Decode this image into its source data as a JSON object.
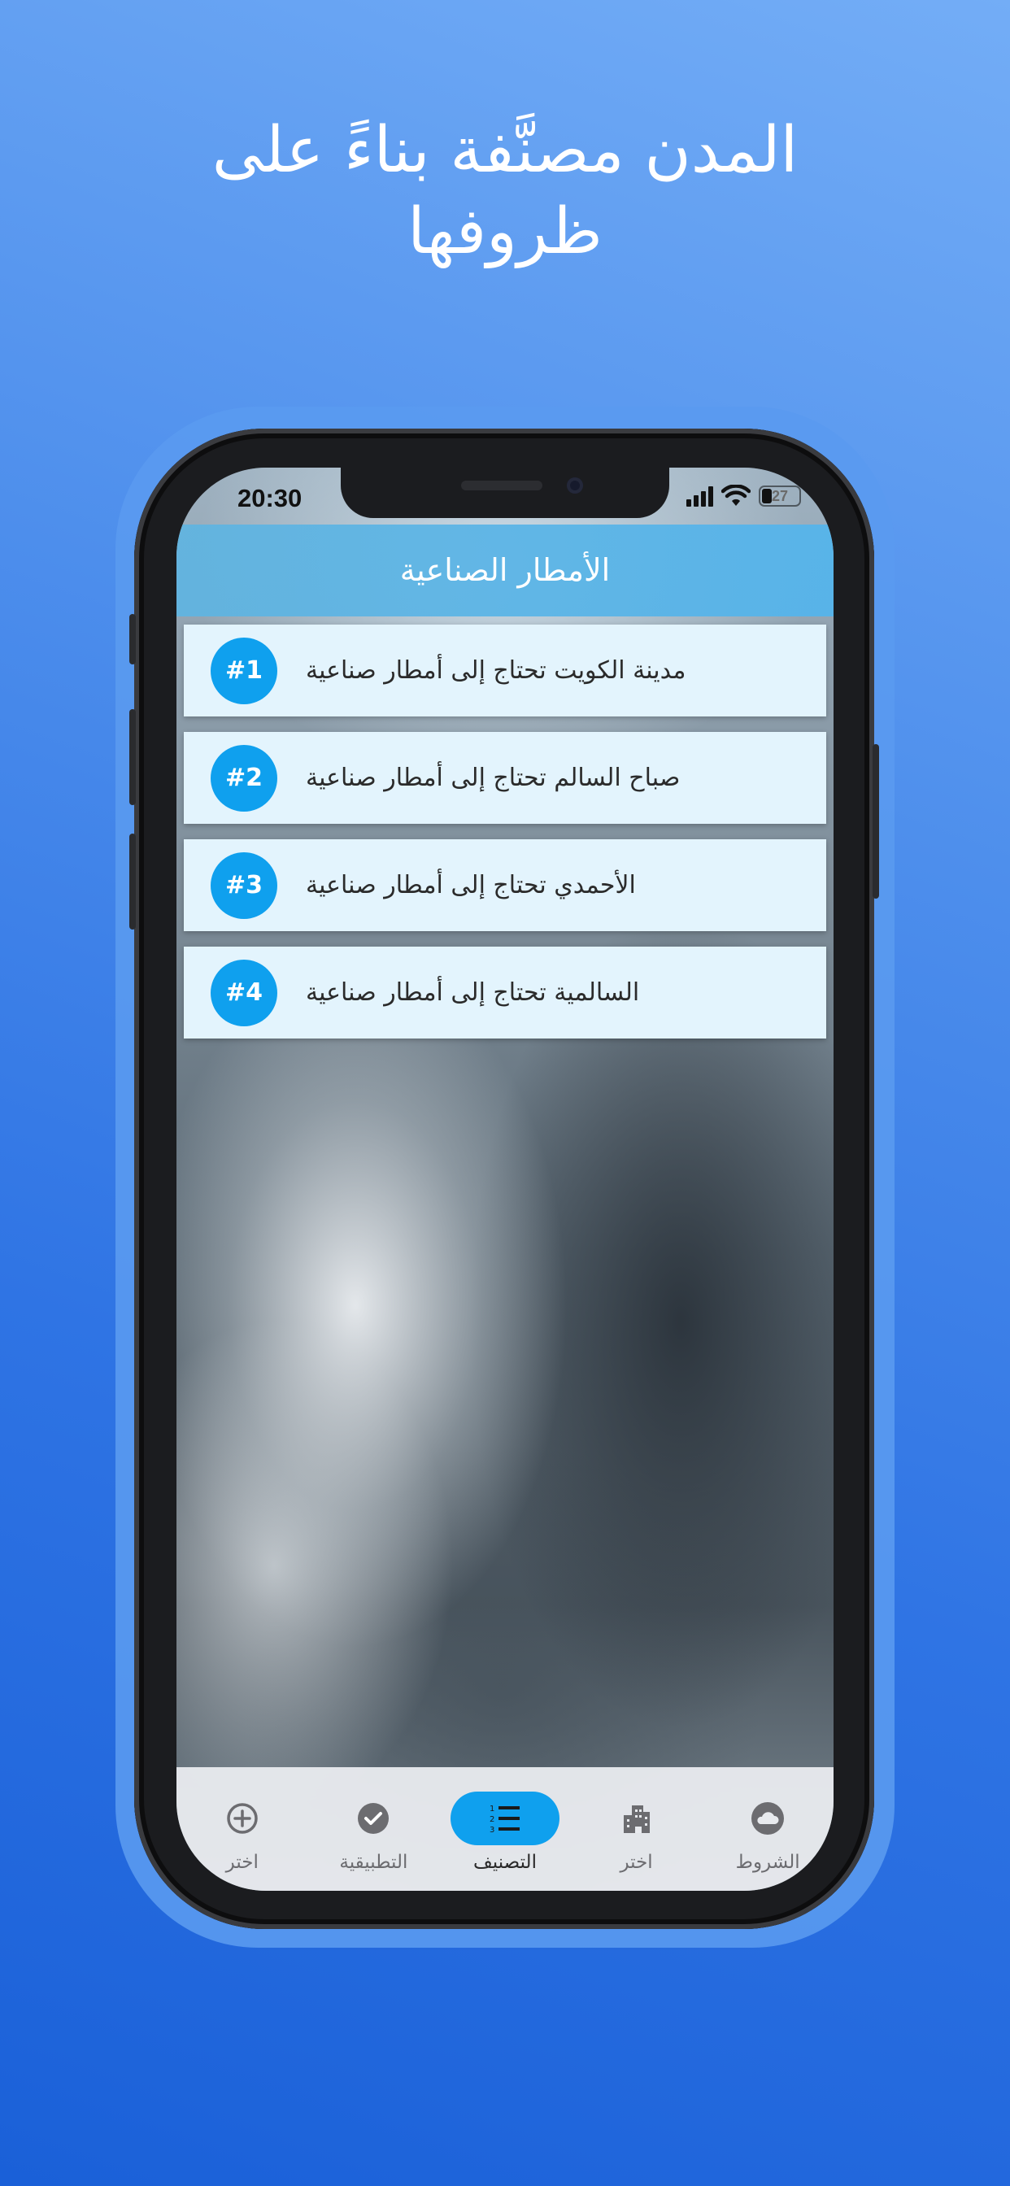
{
  "headline": {
    "line1": "المدن مصنَّفة بناءً على",
    "line2": "ظروفها"
  },
  "status_bar": {
    "time": "20:30",
    "battery_level": "27",
    "icons": [
      "cellular-signal-icon",
      "wifi-icon",
      "battery-icon"
    ]
  },
  "app": {
    "title": "الأمطار الصناعية",
    "items": [
      {
        "badge": "#1",
        "text": "مدينة الكويت تحتاج إلى أمطار صناعية"
      },
      {
        "badge": "#2",
        "text": "صباح السالم تحتاج إلى أمطار صناعية"
      },
      {
        "badge": "#3",
        "text": "الأحمدي تحتاج إلى أمطار صناعية"
      },
      {
        "badge": "#4",
        "text": "السالمية تحتاج إلى أمطار صناعية"
      }
    ],
    "tabs": [
      {
        "label": "اختر",
        "icon": "add-circle-icon",
        "active": false
      },
      {
        "label": "التطبيقية",
        "icon": "check-circle-icon",
        "active": false
      },
      {
        "label": "التصنيف",
        "icon": "numbered-list-icon",
        "active": true
      },
      {
        "label": "اختر",
        "icon": "city-buildings-icon",
        "active": false
      },
      {
        "label": "الشروط",
        "icon": "cloud-icon",
        "active": false
      }
    ]
  },
  "colors": {
    "accent": "#0fa0ee",
    "card_background": "#e3f4fd",
    "header_background": "#5ab4e4",
    "page_background": "#3f84ea"
  }
}
